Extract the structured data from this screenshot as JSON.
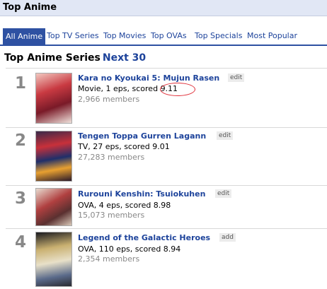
{
  "header": {
    "title": "Top Anime"
  },
  "tabs": [
    {
      "label": "All Anime",
      "active": true
    },
    {
      "label": "Top TV Series",
      "active": false
    },
    {
      "label": "Top Movies",
      "active": false
    },
    {
      "label": "Top OVAs",
      "active": false
    },
    {
      "label": "Top Specials",
      "active": false
    },
    {
      "label": "Most Popular",
      "active": false
    }
  ],
  "section": {
    "heading": "Top Anime Series",
    "next_link": "Next 30"
  },
  "entries": [
    {
      "rank": "1",
      "title": "Kara no Kyoukai 5: Mujun Rasen",
      "button": "edit",
      "info": "Movie, 1 eps, scored ",
      "score": "9.11",
      "members": "2,966 members"
    },
    {
      "rank": "2",
      "title": "Tengen Toppa Gurren Lagann",
      "button": "edit",
      "info": "TV, 27 eps, scored 9.01",
      "members": "27,283 members"
    },
    {
      "rank": "3",
      "title": "Rurouni Kenshin: Tsuiokuhen",
      "button": "edit",
      "info": "OVA, 4 eps, scored 8.98",
      "members": "15,073 members"
    },
    {
      "rank": "4",
      "title": "Legend of the Galactic Heroes",
      "button": "add",
      "info": "OVA, 110 eps, scored 8.94",
      "members": "2,354 members"
    }
  ],
  "colors": {
    "header_bg": "#e1e7f5",
    "tab_active_bg": "#2e51a2",
    "link": "#1d439b",
    "rank": "#888888",
    "score_highlight": "#e0303a"
  }
}
